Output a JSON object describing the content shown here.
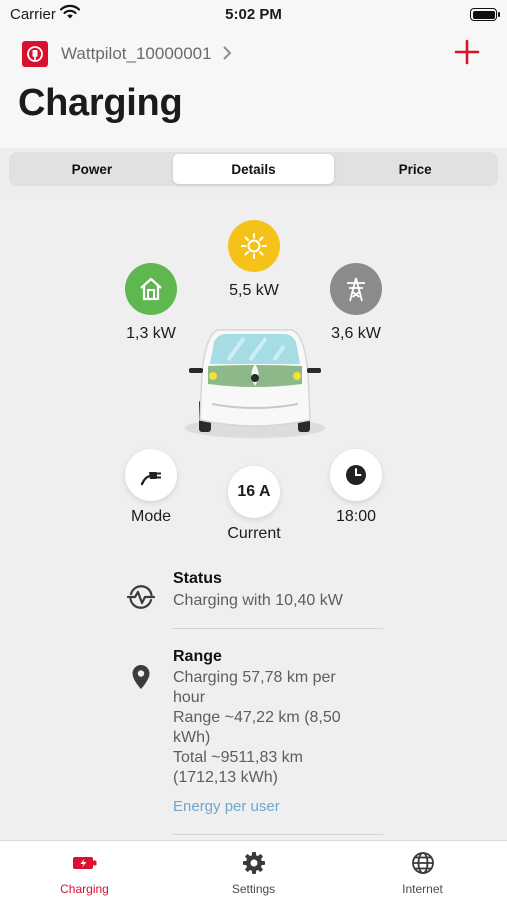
{
  "status_bar": {
    "carrier": "Carrier",
    "time": "5:02 PM"
  },
  "header": {
    "device_name": "Wattpilot_10000001",
    "title": "Charging"
  },
  "tabs": [
    {
      "label": "Power",
      "active": false
    },
    {
      "label": "Details",
      "active": true
    },
    {
      "label": "Price",
      "active": false
    }
  ],
  "flow": {
    "solar": {
      "value": "5,5 kW",
      "icon": "sun-icon",
      "color": "#f5c219"
    },
    "house": {
      "value": "1,3 kW",
      "icon": "house-icon",
      "color": "#5fb84f"
    },
    "grid": {
      "value": "3,6 kW",
      "icon": "power-tower-icon",
      "color": "#8b8b8b"
    }
  },
  "controls": {
    "mode": {
      "label": "Mode",
      "icon": "plug-icon"
    },
    "current": {
      "value": "16 A",
      "label": "Current"
    },
    "timer": {
      "value": "18:00",
      "icon": "clock-icon"
    }
  },
  "status": {
    "title": "Status",
    "text": "Charging with 10,40 kW"
  },
  "range": {
    "title": "Range",
    "lines": [
      "Charging 57,78 km per",
      "hour",
      "Range ~47,22 km (8,50",
      "kWh)",
      "Total ~9511,83 km",
      "(1712,13 kWh)"
    ],
    "link": "Energy per user"
  },
  "bottom_nav": [
    {
      "label": "Charging",
      "icon": "charger-icon",
      "active": true
    },
    {
      "label": "Settings",
      "icon": "gear-icon",
      "active": false
    },
    {
      "label": "Internet",
      "icon": "globe-icon",
      "active": false
    }
  ],
  "colors": {
    "accent": "#d9112f",
    "link": "#6ba7cf"
  }
}
